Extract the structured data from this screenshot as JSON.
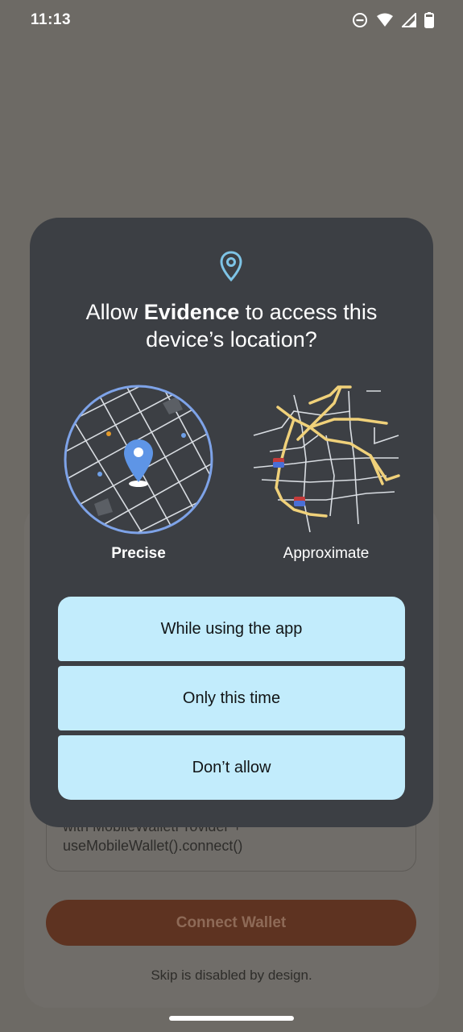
{
  "status_bar": {
    "time": "11:13",
    "icons": [
      "do-not-disturb-icon",
      "wifi-icon",
      "cell-signal-icon",
      "battery-icon"
    ]
  },
  "dialog": {
    "title_prefix": "Allow ",
    "app_name": "Evidence",
    "title_suffix": " to access this device’s location?",
    "options": [
      {
        "label": "Precise",
        "selected": true
      },
      {
        "label": "Approximate",
        "selected": false
      }
    ],
    "buttons": [
      "While using the app",
      "Only this time",
      "Don’t allow"
    ],
    "colors": {
      "dialog_bg": "#3c3f44",
      "button_bg": "#c2ecfc",
      "accent": "#7ea3e8"
    }
  },
  "background_app": {
    "code_line1": "with MobileWalletProvider +",
    "code_line2": "useMobileWallet().connect()",
    "connect_button": "Connect Wallet",
    "skip_note": "Skip is disabled by design."
  }
}
